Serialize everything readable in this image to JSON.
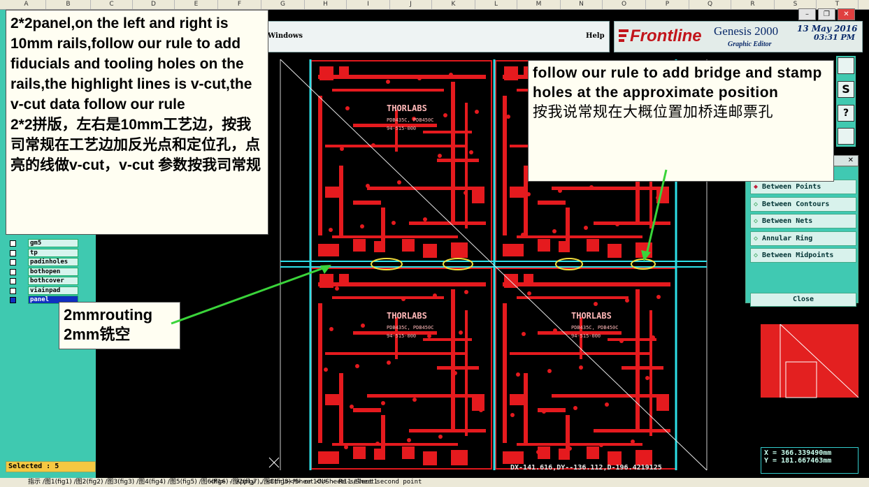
{
  "columns": [
    "A",
    "B",
    "C",
    "D",
    "E",
    "F",
    "G",
    "H",
    "I",
    "J",
    "K",
    "L",
    "M",
    "N",
    "O",
    "P",
    "Q",
    "R",
    "S",
    "T"
  ],
  "menu": {
    "windows": "Windows",
    "help": "Help"
  },
  "brand": {
    "logo": "Frontline",
    "app": "Genesis 2000",
    "subtitle": "Graphic Editor",
    "date": "13 May 2016",
    "time": "03:31 PM"
  },
  "layers": [
    "gm5",
    "tp",
    "padinholes",
    "bothopen",
    "bothcover",
    "viainpad",
    "panel"
  ],
  "selected": "Selected : 5",
  "measure_panel": {
    "options": [
      "Between Points",
      "Between Contours",
      "Between Nets",
      "Annular Ring",
      "Between Midpoints"
    ],
    "close": "Close"
  },
  "coords": {
    "x": "X = 366.339490mm",
    "y": "Y = 181.667463mm"
  },
  "readout": "DX-141.616,DY--136.112,D-196.4219125",
  "status": "<M1> - Apply , <Ctrl><M> or <N> - Re-select second point",
  "sheet_tabs": "指示 /图1(fig1) /图2(fig2) /图3(fig3) /图4(fig4) /图5(fig5) /图6(fig6) /图7(fig7) /图8(fig8) /Sheet10 /Sheet11 /Sheet1",
  "board": {
    "brand": "THORLABS",
    "part": "PDB435C, PDB450C",
    "num": "94-515-000"
  },
  "callouts": {
    "left": {
      "en": "2*2panel,on the left and right is 10mm rails,follow our rule to add fiducials and tooling holes on the rails,the highlight lines is v-cut,the v-cut data follow our rule",
      "cn": "2*2拼版，左右是10mm工艺边，按我司常规在工艺边加反光点和定位孔，点亮的线做v-cut，v-cut 参数按我司常规"
    },
    "right": {
      "en": "follow our rule to add bridge and stamp holes at the approximate position",
      "cn": "按我说常规在大概位置加桥连邮票孔"
    },
    "routing": {
      "en": "2mmrouting",
      "cn": "2mm铣空"
    }
  }
}
